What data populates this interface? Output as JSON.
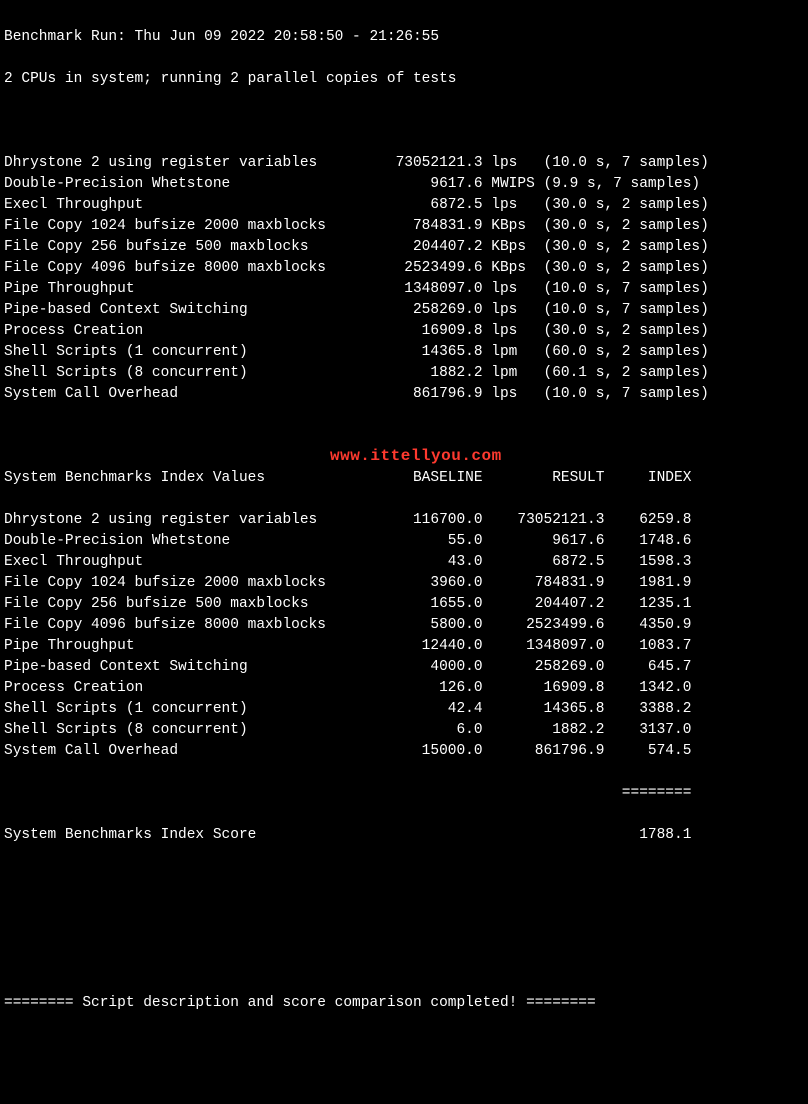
{
  "header": {
    "run_line": "Benchmark Run: Thu Jun 09 2022 20:58:50 - 21:26:55",
    "cpu_line": "2 CPUs in system; running 2 parallel copies of tests"
  },
  "results": [
    {
      "name": "Dhrystone 2 using register variables",
      "value": "73052121.3",
      "unit": "lps",
      "timing": "(10.0 s, 7 samples)"
    },
    {
      "name": "Double-Precision Whetstone",
      "value": "9617.6",
      "unit": "MWIPS",
      "timing": "(9.9 s, 7 samples)"
    },
    {
      "name": "Execl Throughput",
      "value": "6872.5",
      "unit": "lps",
      "timing": "(30.0 s, 2 samples)"
    },
    {
      "name": "File Copy 1024 bufsize 2000 maxblocks",
      "value": "784831.9",
      "unit": "KBps",
      "timing": "(30.0 s, 2 samples)"
    },
    {
      "name": "File Copy 256 bufsize 500 maxblocks",
      "value": "204407.2",
      "unit": "KBps",
      "timing": "(30.0 s, 2 samples)"
    },
    {
      "name": "File Copy 4096 bufsize 8000 maxblocks",
      "value": "2523499.6",
      "unit": "KBps",
      "timing": "(30.0 s, 2 samples)"
    },
    {
      "name": "Pipe Throughput",
      "value": "1348097.0",
      "unit": "lps",
      "timing": "(10.0 s, 7 samples)"
    },
    {
      "name": "Pipe-based Context Switching",
      "value": "258269.0",
      "unit": "lps",
      "timing": "(10.0 s, 7 samples)"
    },
    {
      "name": "Process Creation",
      "value": "16909.8",
      "unit": "lps",
      "timing": "(30.0 s, 2 samples)"
    },
    {
      "name": "Shell Scripts (1 concurrent)",
      "value": "14365.8",
      "unit": "lpm",
      "timing": "(60.0 s, 2 samples)"
    },
    {
      "name": "Shell Scripts (8 concurrent)",
      "value": "1882.2",
      "unit": "lpm",
      "timing": "(60.1 s, 2 samples)"
    },
    {
      "name": "System Call Overhead",
      "value": "861796.9",
      "unit": "lps",
      "timing": "(10.0 s, 7 samples)"
    }
  ],
  "index_header": {
    "title": "System Benchmarks Index Values",
    "col_baseline": "BASELINE",
    "col_result": "RESULT",
    "col_index": "INDEX"
  },
  "index_rows": [
    {
      "name": "Dhrystone 2 using register variables",
      "baseline": "116700.0",
      "result": "73052121.3",
      "index": "6259.8"
    },
    {
      "name": "Double-Precision Whetstone",
      "baseline": "55.0",
      "result": "9617.6",
      "index": "1748.6"
    },
    {
      "name": "Execl Throughput",
      "baseline": "43.0",
      "result": "6872.5",
      "index": "1598.3"
    },
    {
      "name": "File Copy 1024 bufsize 2000 maxblocks",
      "baseline": "3960.0",
      "result": "784831.9",
      "index": "1981.9"
    },
    {
      "name": "File Copy 256 bufsize 500 maxblocks",
      "baseline": "1655.0",
      "result": "204407.2",
      "index": "1235.1"
    },
    {
      "name": "File Copy 4096 bufsize 8000 maxblocks",
      "baseline": "5800.0",
      "result": "2523499.6",
      "index": "4350.9"
    },
    {
      "name": "Pipe Throughput",
      "baseline": "12440.0",
      "result": "1348097.0",
      "index": "1083.7"
    },
    {
      "name": "Pipe-based Context Switching",
      "baseline": "4000.0",
      "result": "258269.0",
      "index": "645.7"
    },
    {
      "name": "Process Creation",
      "baseline": "126.0",
      "result": "16909.8",
      "index": "1342.0"
    },
    {
      "name": "Shell Scripts (1 concurrent)",
      "baseline": "42.4",
      "result": "14365.8",
      "index": "3388.2"
    },
    {
      "name": "Shell Scripts (8 concurrent)",
      "baseline": "6.0",
      "result": "1882.2",
      "index": "3137.0"
    },
    {
      "name": "System Call Overhead",
      "baseline": "15000.0",
      "result": "861796.9",
      "index": "574.5"
    }
  ],
  "separator": "========",
  "score_label": "System Benchmarks Index Score",
  "score_value": "1788.1",
  "footer": "======== Script description and score comparison completed! ========",
  "watermark": "www.ittellyou.com"
}
